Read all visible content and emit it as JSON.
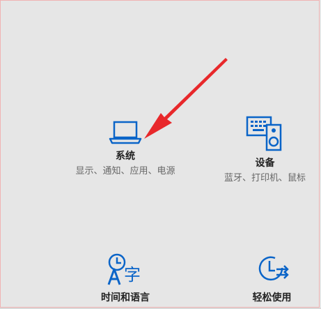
{
  "tiles": [
    {
      "title": "系统",
      "description": "显示、通知、应用、电源",
      "icon": "laptop-icon"
    },
    {
      "title": "设备",
      "description": "蓝牙、打印机、鼠标",
      "icon": "keyboard-speaker-icon"
    },
    {
      "title": "时间和语言",
      "description": "",
      "icon": "time-language-icon"
    },
    {
      "title": "轻松使用",
      "description": "",
      "icon": "ease-of-access-icon"
    }
  ],
  "annotation": {
    "type": "red-arrow",
    "color": "#e8282b"
  },
  "colors": {
    "accent": "#0a64c8",
    "background": "#e6e6e6"
  }
}
